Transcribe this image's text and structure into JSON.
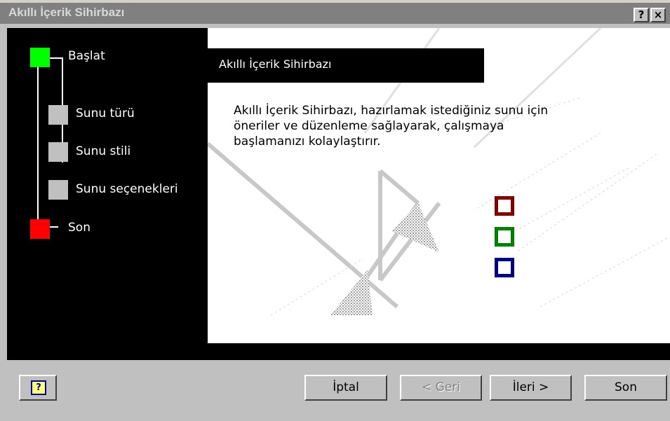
{
  "window": {
    "title": "Akıllı İçerik Sihirbazı",
    "help_button": "?",
    "close_button": "×"
  },
  "steps": [
    {
      "label": "Başlat",
      "color": "#00ff00"
    },
    {
      "label": "Sunu türü",
      "color": "#c0c0c0"
    },
    {
      "label": "Sunu stili",
      "color": "#c0c0c0"
    },
    {
      "label": "Sunu seçenekleri",
      "color": "#c0c0c0"
    },
    {
      "label": "Son",
      "color": "#ff0000"
    }
  ],
  "panel": {
    "heading": "Akıllı İçerik Sihirbazı",
    "description": "Akıllı İçerik Sihirbazı, hazırlamak istediğiniz sunu için öneriler ve düzenleme sağlayarak, çalışmaya başlamanızı kolaylaştırır."
  },
  "decoration": {
    "square_colors": [
      "#800000",
      "#008000",
      "#000080"
    ],
    "icon": "wizard-graphic"
  },
  "buttons": {
    "help": "?",
    "cancel": "İptal",
    "back": "< Geri",
    "next": "İleri >",
    "finish": "Son"
  }
}
